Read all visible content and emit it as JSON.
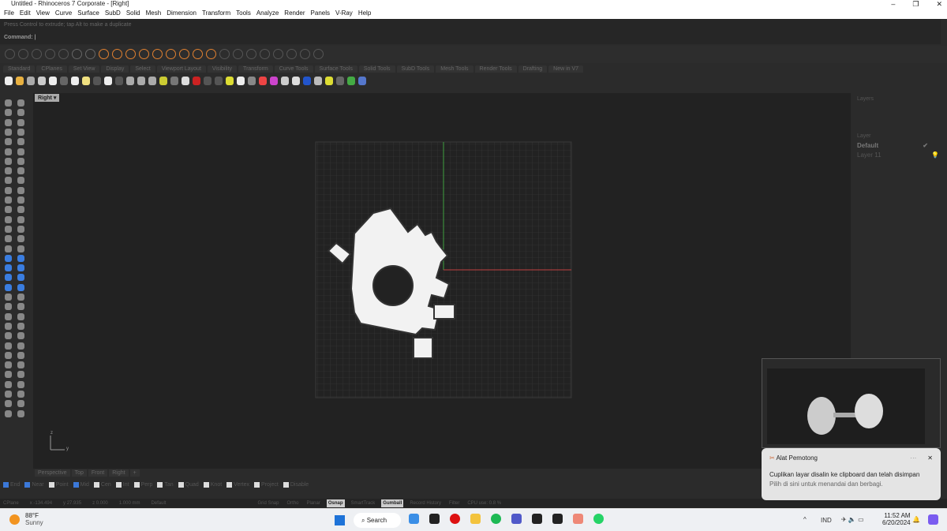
{
  "window": {
    "title": "Untitled - Rhinoceros 7 Corporate - [Right]"
  },
  "menu": [
    "File",
    "Edit",
    "View",
    "Curve",
    "Surface",
    "SubD",
    "Solid",
    "Mesh",
    "Dimension",
    "Transform",
    "Tools",
    "Analyze",
    "Render",
    "Panels",
    "V-Ray",
    "Help"
  ],
  "command": {
    "history": "Press Control to extrude; tap Alt to make a duplicate",
    "prompt": "Command:"
  },
  "toolbar_tabs": [
    "Standard",
    "CPlanes",
    "Set View",
    "Display",
    "Select",
    "Viewport Layout",
    "Visibility",
    "Transform",
    "Curve Tools",
    "Surface Tools",
    "Solid Tools",
    "SubD Tools",
    "Mesh Tools",
    "Render Tools",
    "Drafting",
    "New in V7"
  ],
  "viewport": {
    "label": "Right",
    "axis_z": "z",
    "axis_y": "y"
  },
  "layers": {
    "title": "Layers",
    "column": "Layer",
    "items": [
      {
        "name": "Default",
        "current": true
      },
      {
        "name": "Layer 11"
      }
    ]
  },
  "viewport_tabs": [
    "Perspective",
    "Top",
    "Front",
    "Right",
    "+"
  ],
  "osnaps": [
    {
      "label": "End",
      "on": true
    },
    {
      "label": "Near",
      "on": true
    },
    {
      "label": "Point",
      "on": false
    },
    {
      "label": "Mid",
      "on": true
    },
    {
      "label": "Cen",
      "on": false
    },
    {
      "label": "Int",
      "on": false
    },
    {
      "label": "Perp",
      "on": false
    },
    {
      "label": "Tan",
      "on": false
    },
    {
      "label": "Quad",
      "on": false
    },
    {
      "label": "Knot",
      "on": false
    },
    {
      "label": "Vertex",
      "on": false
    },
    {
      "label": "Project",
      "on": false
    },
    {
      "label": "Disable",
      "on": false
    }
  ],
  "status": {
    "cplane": "CPlane",
    "x": "x -134.494",
    "y": "y 27.935",
    "z": "z 0.000",
    "units": "1.000 mm",
    "layer": "Default",
    "panes": [
      {
        "label": "Grid Snap",
        "on": false
      },
      {
        "label": "Ortho",
        "on": false
      },
      {
        "label": "Planar",
        "on": false
      },
      {
        "label": "Osnap",
        "on": true
      },
      {
        "label": "SmartTrack",
        "on": false
      },
      {
        "label": "Gumball",
        "on": true
      },
      {
        "label": "Record History",
        "on": false
      },
      {
        "label": "Filter",
        "on": false
      },
      {
        "label": "CPU use: 0.8 %",
        "on": false
      }
    ]
  },
  "toast": {
    "app": "Alat Pemotong",
    "message": "Cuplikan layar disalin ke clipboard dan telah disimpan",
    "sub": "Pilih di sini untuk menandai dan berbagi.",
    "more": "···",
    "close": "✕"
  },
  "taskbar": {
    "weather_temp": "88°F",
    "weather_desc": "Sunny",
    "search": "Search",
    "lang": "IND",
    "time": "11:52 AM",
    "date": "6/20/2024",
    "badges": {
      "mail": "25",
      "teams": "9+",
      "whatsapp": "18"
    }
  },
  "colors": {
    "x_axis": "#c04040",
    "y_axis": "#40a040",
    "accent": "#3b78d8"
  }
}
